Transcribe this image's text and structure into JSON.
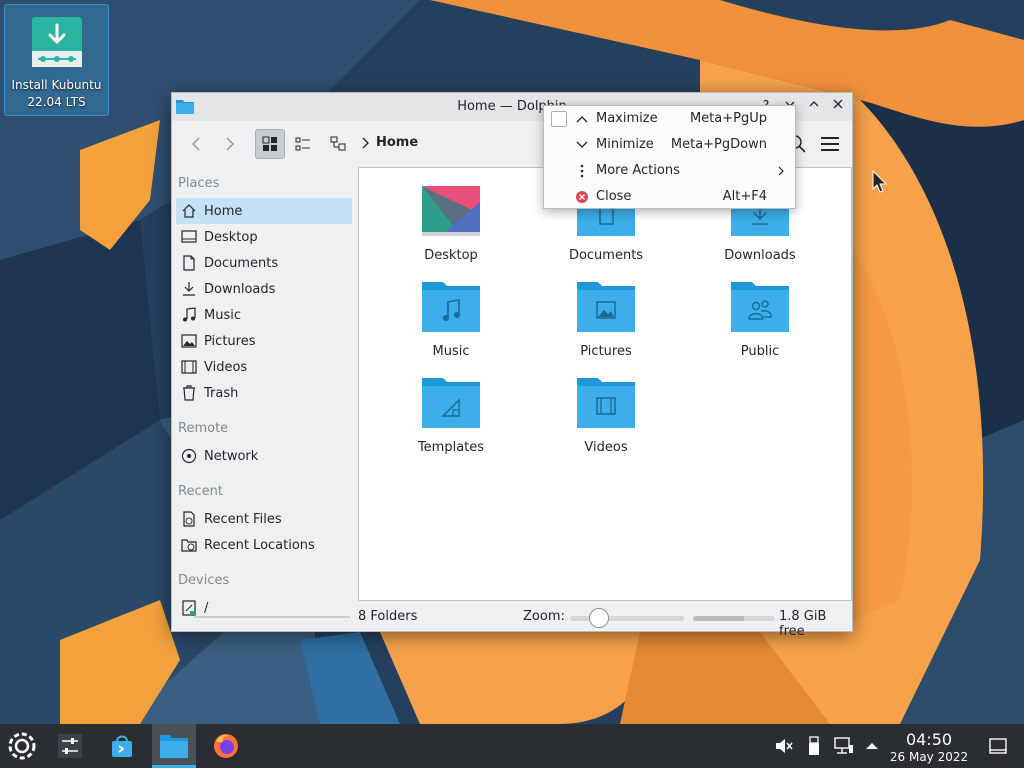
{
  "desktop": {
    "install_icon_label_line1": "Install Kubuntu",
    "install_icon_label_line2": "22.04 LTS"
  },
  "window": {
    "title": "Home — Dolphin",
    "help_glyph": "?",
    "breadcrumb": "Home"
  },
  "places": {
    "sections": [
      "Places",
      "Remote",
      "Recent",
      "Devices"
    ],
    "items": [
      {
        "label": "Home",
        "icon": "home-icon",
        "selected": true
      },
      {
        "label": "Desktop",
        "icon": "desktop-icon"
      },
      {
        "label": "Documents",
        "icon": "documents-icon"
      },
      {
        "label": "Downloads",
        "icon": "downloads-icon"
      },
      {
        "label": "Music",
        "icon": "music-icon"
      },
      {
        "label": "Pictures",
        "icon": "pictures-icon"
      },
      {
        "label": "Videos",
        "icon": "videos-icon"
      },
      {
        "label": "Trash",
        "icon": "trash-icon"
      }
    ],
    "remote": [
      {
        "label": "Network",
        "icon": "network-icon"
      }
    ],
    "recent": [
      {
        "label": "Recent Files",
        "icon": "recent-files-icon"
      },
      {
        "label": "Recent Locations",
        "icon": "recent-locations-icon"
      }
    ],
    "devices": [
      {
        "label": "/",
        "icon": "drive-icon"
      }
    ]
  },
  "files": [
    {
      "name": "Desktop",
      "icon": "desktop-folder-icon"
    },
    {
      "name": "Documents",
      "icon": "documents-folder-icon"
    },
    {
      "name": "Downloads",
      "icon": "downloads-folder-icon"
    },
    {
      "name": "Music",
      "icon": "music-folder-icon"
    },
    {
      "name": "Pictures",
      "icon": "pictures-folder-icon"
    },
    {
      "name": "Public",
      "icon": "public-folder-icon"
    },
    {
      "name": "Templates",
      "icon": "templates-folder-icon"
    },
    {
      "name": "Videos",
      "icon": "videos-folder-icon"
    }
  ],
  "status": {
    "count": "8 Folders",
    "zoom_label": "Zoom:",
    "zoom_level": 0.2,
    "free_space": "1.8 GiB free",
    "used_fraction": 0.62
  },
  "context_menu": {
    "items": [
      {
        "label": "Maximize",
        "shortcut": "Meta+PgUp",
        "icon": "chevron-up-icon"
      },
      {
        "label": "Minimize",
        "shortcut": "Meta+PgDown",
        "icon": "chevron-down-icon"
      },
      {
        "label": "More Actions",
        "shortcut": "",
        "icon": "more-actions-icon"
      },
      {
        "label": "Close",
        "shortcut": "Alt+F4",
        "icon": "close-icon"
      }
    ]
  },
  "taskbar": {
    "time": "04:50",
    "date": "26 May 2022"
  },
  "colors": {
    "folder": "#3daee9",
    "folder_tab": "#1d99d9",
    "selection": "#c4e1f5",
    "taskbar": "#2a2e32"
  }
}
